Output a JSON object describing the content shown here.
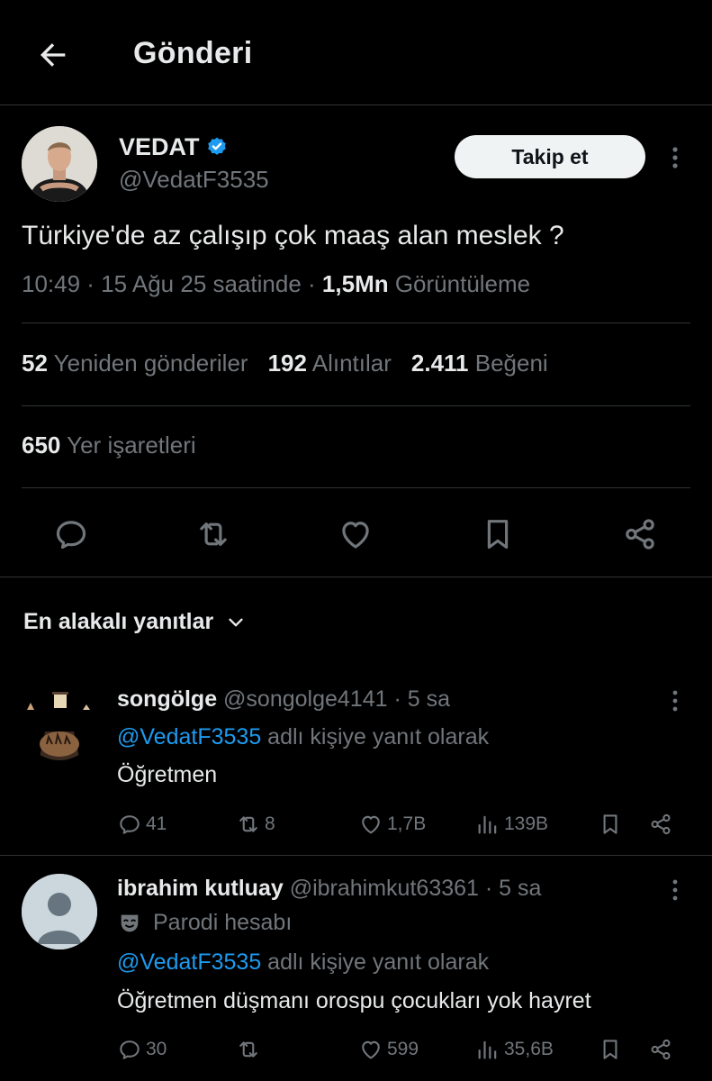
{
  "header": {
    "title": "Gönderi"
  },
  "author": {
    "name": "VEDAT",
    "handle": "@VedatF3535",
    "follow_label": "Takip et"
  },
  "tweet": {
    "text": "Türkiye'de az çalışıp çok maaş alan meslek ?",
    "time": "10:49 · 15 Ağu 25 saatinde · ",
    "views_count": "1,5Mn",
    "views_label": " Görüntüleme"
  },
  "stats": {
    "reposts_count": "52",
    "reposts_label": " Yeniden gönderiler",
    "quotes_count": "192",
    "quotes_label": " Alıntılar",
    "likes_count": "2.411",
    "likes_label": " Beğeni",
    "bookmarks_count": "650",
    "bookmarks_label": " Yer işaretleri"
  },
  "sort": {
    "label": "En alakalı yanıtlar"
  },
  "replies": [
    {
      "name": "songölge",
      "handle": " @songolge4141",
      "time": " · 5 sa",
      "reply_to_mention": "@VedatF3535",
      "reply_to_suffix": " adlı kişiye yanıt olarak",
      "text": "Öğretmen",
      "comments": "41",
      "reposts": "8",
      "likes": "1,7B",
      "views": "139B"
    },
    {
      "name": "ibrahim kutluay",
      "handle": " @ibrahimkut63361",
      "time": " · 5 sa",
      "parody_label": "Parodi hesabı",
      "reply_to_mention": "@VedatF3535",
      "reply_to_suffix": " adlı kişiye yanıt olarak",
      "text": "Öğretmen düşmanı orospu çocukları yok hayret",
      "comments": "30",
      "reposts": "",
      "likes": "599",
      "views": "35,6B"
    }
  ],
  "colors": {
    "background": "#000000",
    "text": "#e7e9ea",
    "muted": "#71767b",
    "accent": "#1d9bf0",
    "divider": "#2f3336"
  }
}
